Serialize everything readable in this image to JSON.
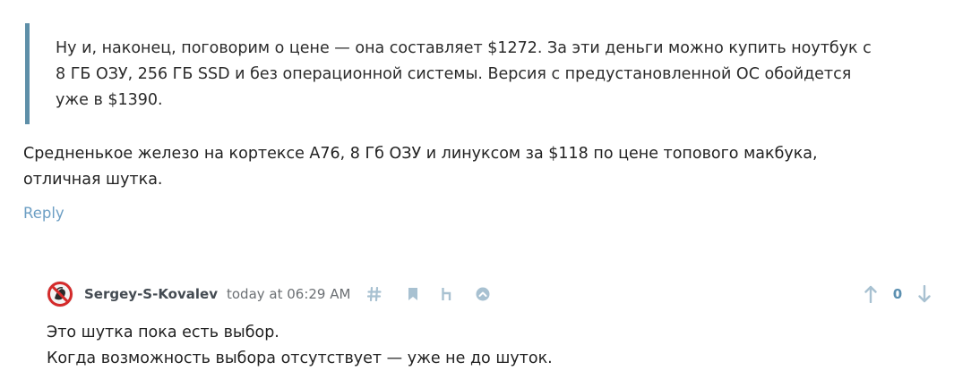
{
  "parent_comment": {
    "quote_text": "Ну и, наконец, поговорим о цене — она составляет $1272. За эти деньги можно купить ноутбук с 8 ГБ ОЗУ, 256 ГБ SSD и без операционной системы. Версия с предустановленной ОС обойдется уже в $1390.",
    "body_text": "Средненькое железо на кортексе A76, 8 Гб ОЗУ и линуксом за $118 по цене топового макбука, отличная шутка.",
    "reply_label": "Reply"
  },
  "reply": {
    "username": "Sergey-S-Kovalev",
    "timestamp": "today at 06:29 AM",
    "vote_count": "0",
    "lines": [
      "Это шутка пока есть выбор.",
      "Когда возможность выбора отсутствует — уже не до шуток."
    ],
    "icons": {
      "permalink": "hash-icon",
      "bookmark": "bookmark-icon",
      "parent": "parent-comment-icon",
      "collapse": "collapse-icon",
      "upvote": "arrow-up-icon",
      "downvote": "arrow-down-icon"
    }
  },
  "colors": {
    "quote_border": "#5e8fa8",
    "link": "#6d9fc4",
    "icon": "#a8c1d1",
    "vote_count": "#5b8fb0",
    "avatar_red": "#d42a2a"
  }
}
